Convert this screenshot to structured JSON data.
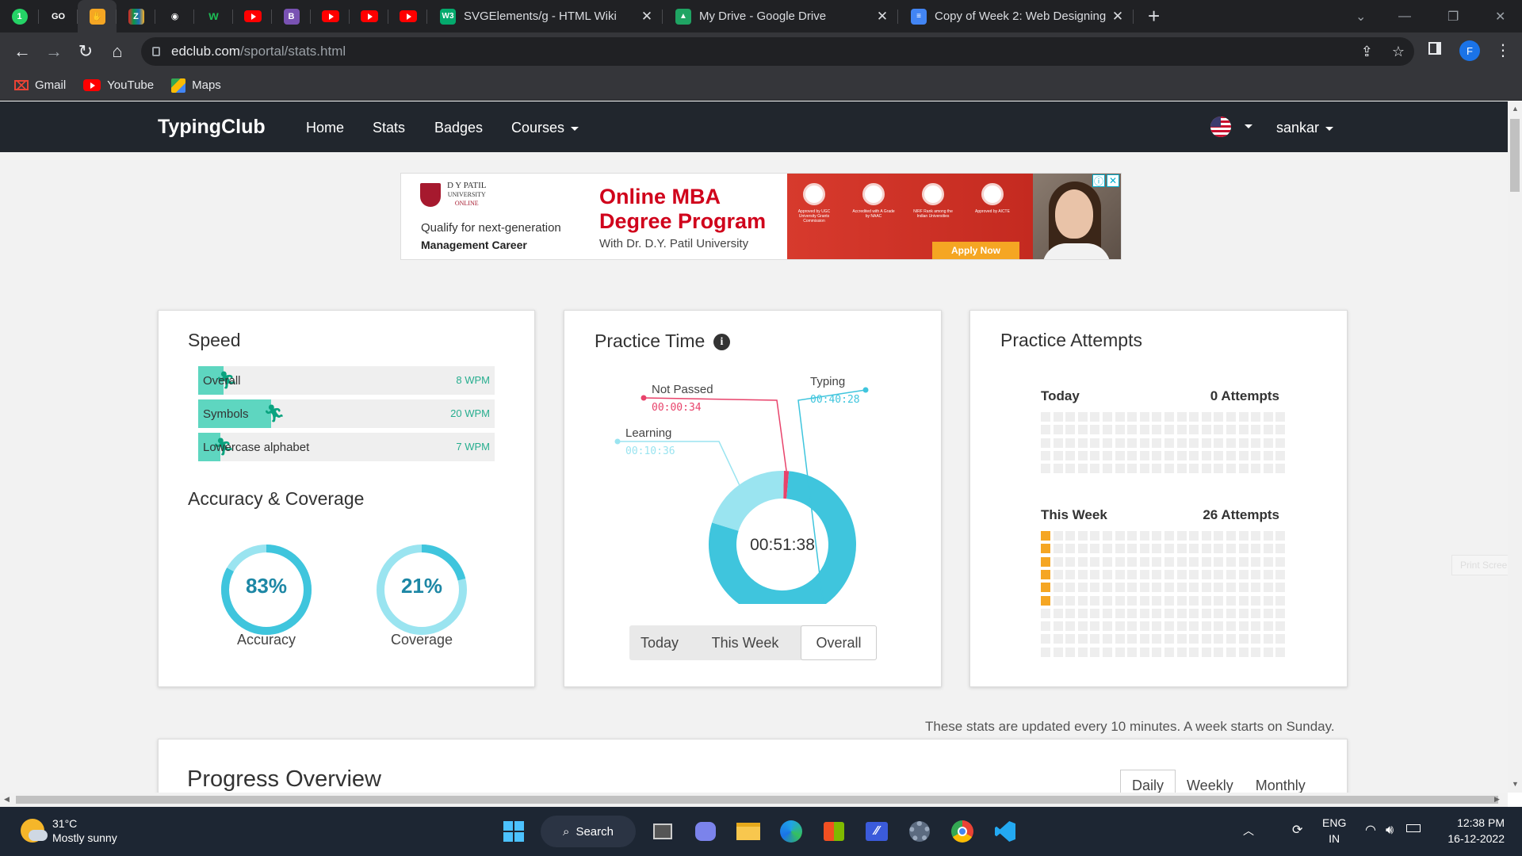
{
  "browser": {
    "pinned_tabs": [
      {
        "name": "whatsapp-tab",
        "icon": "whatsapp-icon",
        "color": "#25d366",
        "glyph": "1"
      },
      {
        "name": "tab-go",
        "icon": "go-logo-icon",
        "color": "#202124",
        "glyph": "GO"
      },
      {
        "name": "tab-hand",
        "icon": "waving-hand-icon",
        "color": "#f5a623",
        "glyph": "✋"
      },
      {
        "name": "tab-zoho",
        "icon": "zoho-icon",
        "color": "#4a4b4f",
        "glyph": "Z"
      },
      {
        "name": "tab-github",
        "icon": "github-icon",
        "color": "#202124",
        "glyph": "◉"
      },
      {
        "name": "tab-w",
        "icon": "w-logo-icon",
        "color": "#202124",
        "glyph": "w"
      },
      {
        "name": "tab-youtube-1",
        "icon": "youtube-icon",
        "color": "#ff0000",
        "glyph": ""
      },
      {
        "name": "tab-bootstrap",
        "icon": "bootstrap-icon",
        "color": "#7952b3",
        "glyph": "B"
      },
      {
        "name": "tab-youtube-2",
        "icon": "youtube-icon",
        "color": "#ff0000",
        "glyph": ""
      },
      {
        "name": "tab-youtube-3",
        "icon": "youtube-icon",
        "color": "#ff0000",
        "glyph": ""
      },
      {
        "name": "tab-youtube-4",
        "icon": "youtube-icon",
        "color": "#ff0000",
        "glyph": ""
      }
    ],
    "tabs": [
      {
        "title": "SVGElements/g - HTML Wiki",
        "icon_glyph": "W3"
      },
      {
        "title": "My Drive - Google Drive",
        "icon_glyph": "▲"
      },
      {
        "title": "Copy of Week 2: Web Designing",
        "icon_glyph": "≡"
      }
    ],
    "url_host": "edclub.com",
    "url_path": "/sportal/stats.html",
    "profile_initial": "F",
    "bookmarks": [
      {
        "label": "Gmail",
        "icon": "gmail-icon"
      },
      {
        "label": "YouTube",
        "icon": "youtube-icon"
      },
      {
        "label": "Maps",
        "icon": "maps-icon"
      }
    ]
  },
  "site": {
    "brand": "TypingClub",
    "nav": [
      {
        "label": "Home"
      },
      {
        "label": "Stats"
      },
      {
        "label": "Badges"
      },
      {
        "label": "Courses"
      }
    ],
    "username": "sankar"
  },
  "ad": {
    "logo_line1": "D Y PATIL",
    "logo_line2": "UNIVERSITY",
    "logo_line3": "ONLINE",
    "qualify": "Qualify for next-generation",
    "career": "Management Career",
    "headline1": "Online MBA",
    "headline2": "Degree Program",
    "sub": "With Dr. D.Y. Patil University",
    "badges": [
      "Approved by UGC University Grants Commission",
      "Accredited with A Grade by NAAC",
      "NIRF Rank among the Indian Universities",
      "Approved by AICTE"
    ],
    "apply": "Apply Now"
  },
  "speed": {
    "title": "Speed",
    "rows": [
      {
        "label": "Overall",
        "value": "8 WPM",
        "fill_fraction": 0.07
      },
      {
        "label": "Symbols",
        "value": "20 WPM",
        "fill_fraction": 0.23
      },
      {
        "label": "Lowercase alphabet",
        "value": "7 WPM",
        "fill_fraction": 0.06
      }
    ]
  },
  "accuracy": {
    "title": "Accuracy & Coverage",
    "accuracy_pct": "83%",
    "accuracy_value": 0.83,
    "accuracy_label": "Accuracy",
    "coverage_pct": "21%",
    "coverage_value": 0.21,
    "coverage_label": "Coverage"
  },
  "practice_time": {
    "title": "Practice Time",
    "total": "00:51:38",
    "segments": [
      {
        "label": "Typing",
        "time": "00:40:28",
        "seconds": 2428,
        "color": "#3fc5dd"
      },
      {
        "label": "Learning",
        "time": "00:10:36",
        "seconds": 636,
        "color": "#9ae4f0"
      },
      {
        "label": "Not Passed",
        "time": "00:00:34",
        "seconds": 34,
        "color": "#e8436b"
      }
    ],
    "ranges": [
      {
        "label": "Today"
      },
      {
        "label": "This Week"
      },
      {
        "label": "Overall",
        "active": true
      }
    ]
  },
  "attempts": {
    "title": "Practice Attempts",
    "today_label": "Today",
    "today_count": "0 Attempts",
    "today_filled": 0,
    "week_label": "This Week",
    "week_count": "26 Attempts",
    "week_filled_column_cells": 6,
    "filled_color": "#f5a623",
    "empty_color": "#eeeeee"
  },
  "footer_note": "These stats are updated every 10 minutes. A week starts on Sunday.",
  "progress": {
    "title": "Progress Overview",
    "tabs": [
      {
        "label": "Daily",
        "active": true
      },
      {
        "label": "Weekly"
      },
      {
        "label": "Monthly"
      }
    ]
  },
  "print_screen": "Print Screen",
  "taskbar": {
    "temp": "31°C",
    "weather": "Mostly sunny",
    "search_label": "Search",
    "lang1": "ENG",
    "lang2": "IN",
    "time": "12:38 PM",
    "date": "16-12-2022"
  }
}
